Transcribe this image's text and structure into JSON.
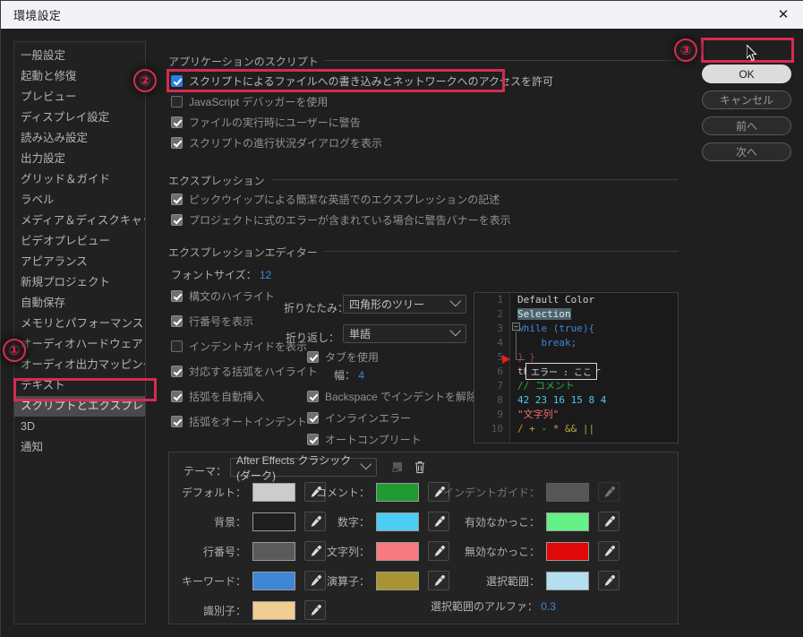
{
  "window": {
    "title": "環境設定",
    "close_icon": "close-icon"
  },
  "sidebar": {
    "items": [
      {
        "label": "一般設定",
        "selected": false
      },
      {
        "label": "起動と修復",
        "selected": false
      },
      {
        "label": "プレビュー",
        "selected": false
      },
      {
        "label": "ディスプレイ設定",
        "selected": false
      },
      {
        "label": "読み込み設定",
        "selected": false
      },
      {
        "label": "出力設定",
        "selected": false
      },
      {
        "label": "グリッド＆ガイド",
        "selected": false
      },
      {
        "label": "ラベル",
        "selected": false
      },
      {
        "label": "メディア＆ディスクキャッシュ",
        "selected": false
      },
      {
        "label": "ビデオプレビュー",
        "selected": false
      },
      {
        "label": "アピアランス",
        "selected": false
      },
      {
        "label": "新規プロジェクト",
        "selected": false
      },
      {
        "label": "自動保存",
        "selected": false
      },
      {
        "label": "メモリとパフォーマンス",
        "selected": false
      },
      {
        "label": "オーディオハードウェア",
        "selected": false
      },
      {
        "label": "オーディオ出力マッピング",
        "selected": false
      },
      {
        "label": "テキスト",
        "selected": false
      },
      {
        "label": "スクリプトとエクスプレッション",
        "selected": true
      },
      {
        "label": "3D",
        "selected": false
      },
      {
        "label": "通知",
        "selected": false
      }
    ]
  },
  "buttons": {
    "ok": "OK",
    "cancel": "キャンセル",
    "prev": "前へ",
    "next": "次へ"
  },
  "app_scripts": {
    "group_title": "アプリケーションのスクリプト",
    "items": [
      {
        "label": "スクリプトによるファイルへの書き込みとネットワークへのアクセスを許可",
        "checked": true,
        "accent": "blue",
        "dim": false
      },
      {
        "label": "JavaScript デバッガーを使用",
        "checked": false,
        "accent": "grey",
        "dim": true
      },
      {
        "label": "ファイルの実行時にユーザーに警告",
        "checked": true,
        "accent": "grey",
        "dim": true
      },
      {
        "label": "スクリプトの進行状況ダイアログを表示",
        "checked": true,
        "accent": "grey",
        "dim": true
      }
    ]
  },
  "expression": {
    "group_title": "エクスプレッション",
    "items": [
      {
        "label": "ピックウイップによる簡潔な英語でのエクスプレッションの記述",
        "checked": true
      },
      {
        "label": "プロジェクトに式のエラーが含まれている場合に警告バナーを表示",
        "checked": true
      }
    ]
  },
  "editor": {
    "group_title": "エクスプレッションエディター",
    "font_size_label": "フォントサイズ：",
    "font_size_value": "12",
    "left_checks": [
      {
        "label": "構文のハイライト",
        "checked": true
      },
      {
        "label": "行番号を表示",
        "checked": true
      },
      {
        "label": "インデントガイドを表示",
        "checked": false
      },
      {
        "label": "対応する括弧をハイライト",
        "checked": true
      },
      {
        "label": "括弧を自動挿入",
        "checked": true
      },
      {
        "label": "括弧をオートインデント",
        "checked": true
      }
    ],
    "fold_label": "折りたたみ：",
    "fold_value": "四角形のツリー",
    "wrap_label": "折り返し：",
    "wrap_value": "単語",
    "right_checks": [
      {
        "label": "タブを使用",
        "checked": true
      },
      {
        "label": "Backspace でインデントを解除",
        "checked": true
      },
      {
        "label": "インラインエラー",
        "checked": true
      },
      {
        "label": "オートコンプリート",
        "checked": true
      }
    ],
    "tab_width_label": "幅：",
    "tab_width_value": "4"
  },
  "code_preview": {
    "line_numbers": [
      "1",
      "2",
      "3",
      "4",
      "5",
      "6",
      "7",
      "8",
      "9",
      "10"
    ],
    "lines": [
      {
        "text": "Default Color",
        "style": "default"
      },
      {
        "text": "Selection",
        "style": "selection"
      },
      {
        "text": "while (true){",
        "style": "keyword"
      },
      {
        "text": "break;",
        "style": "keyword-indent"
      },
      {
        "text": "} }",
        "style": "error"
      },
      {
        "text": "thisComp.layer",
        "style": "identifier"
      },
      {
        "text": "// コメント",
        "style": "comment"
      },
      {
        "text": "42 23 16 15 8 4",
        "style": "number"
      },
      {
        "text": "\"文字列\"",
        "style": "string"
      },
      {
        "text": "/ + - * && ||",
        "style": "operator"
      }
    ],
    "error_tooltip": "エラー : ここ",
    "fold_icon": "fold-collapse-icon",
    "error_marker_icon": "error-arrow-icon"
  },
  "theme": {
    "label": "テーマ：",
    "value": "After Effects クラシック (ダーク)",
    "duplicate_icon": "duplicate-icon",
    "delete_icon": "trash-icon",
    "colors_left": [
      {
        "label": "デフォルト：",
        "hex": "#cccccc",
        "dim": false
      },
      {
        "label": "背景：",
        "hex": "#1e1e1e",
        "dim": false
      },
      {
        "label": "行番号：",
        "hex": "#5a5a5a",
        "dim": false
      },
      {
        "label": "キーワード：",
        "hex": "#3f86d8",
        "dim": false
      },
      {
        "label": "識別子：",
        "hex": "#f0cd91",
        "dim": false
      }
    ],
    "colors_mid": [
      {
        "label": "コメント：",
        "hex": "#1f9b32",
        "dim": false
      },
      {
        "label": "数字：",
        "hex": "#4dcdf4",
        "dim": false
      },
      {
        "label": "文字列：",
        "hex": "#f67a80",
        "dim": false
      },
      {
        "label": "演算子：",
        "hex": "#a89432",
        "dim": false
      }
    ],
    "colors_right": [
      {
        "label": "インデントガイド：",
        "hex": "#565656",
        "dim": true
      },
      {
        "label": "有効なかっこ：",
        "hex": "#64f185",
        "dim": false
      },
      {
        "label": "無効なかっこ：",
        "hex": "#e00808",
        "dim": false
      },
      {
        "label": "選択範囲：",
        "hex": "#b3dff0",
        "dim": false
      }
    ],
    "alpha_label": "選択範囲のアルファ：",
    "alpha_value": "0.3",
    "eyedropper_icon": "eyedropper-icon"
  },
  "annotations": {
    "marker1": "①",
    "marker2": "②",
    "marker3": "③",
    "highlight_color": "#d62b50"
  }
}
